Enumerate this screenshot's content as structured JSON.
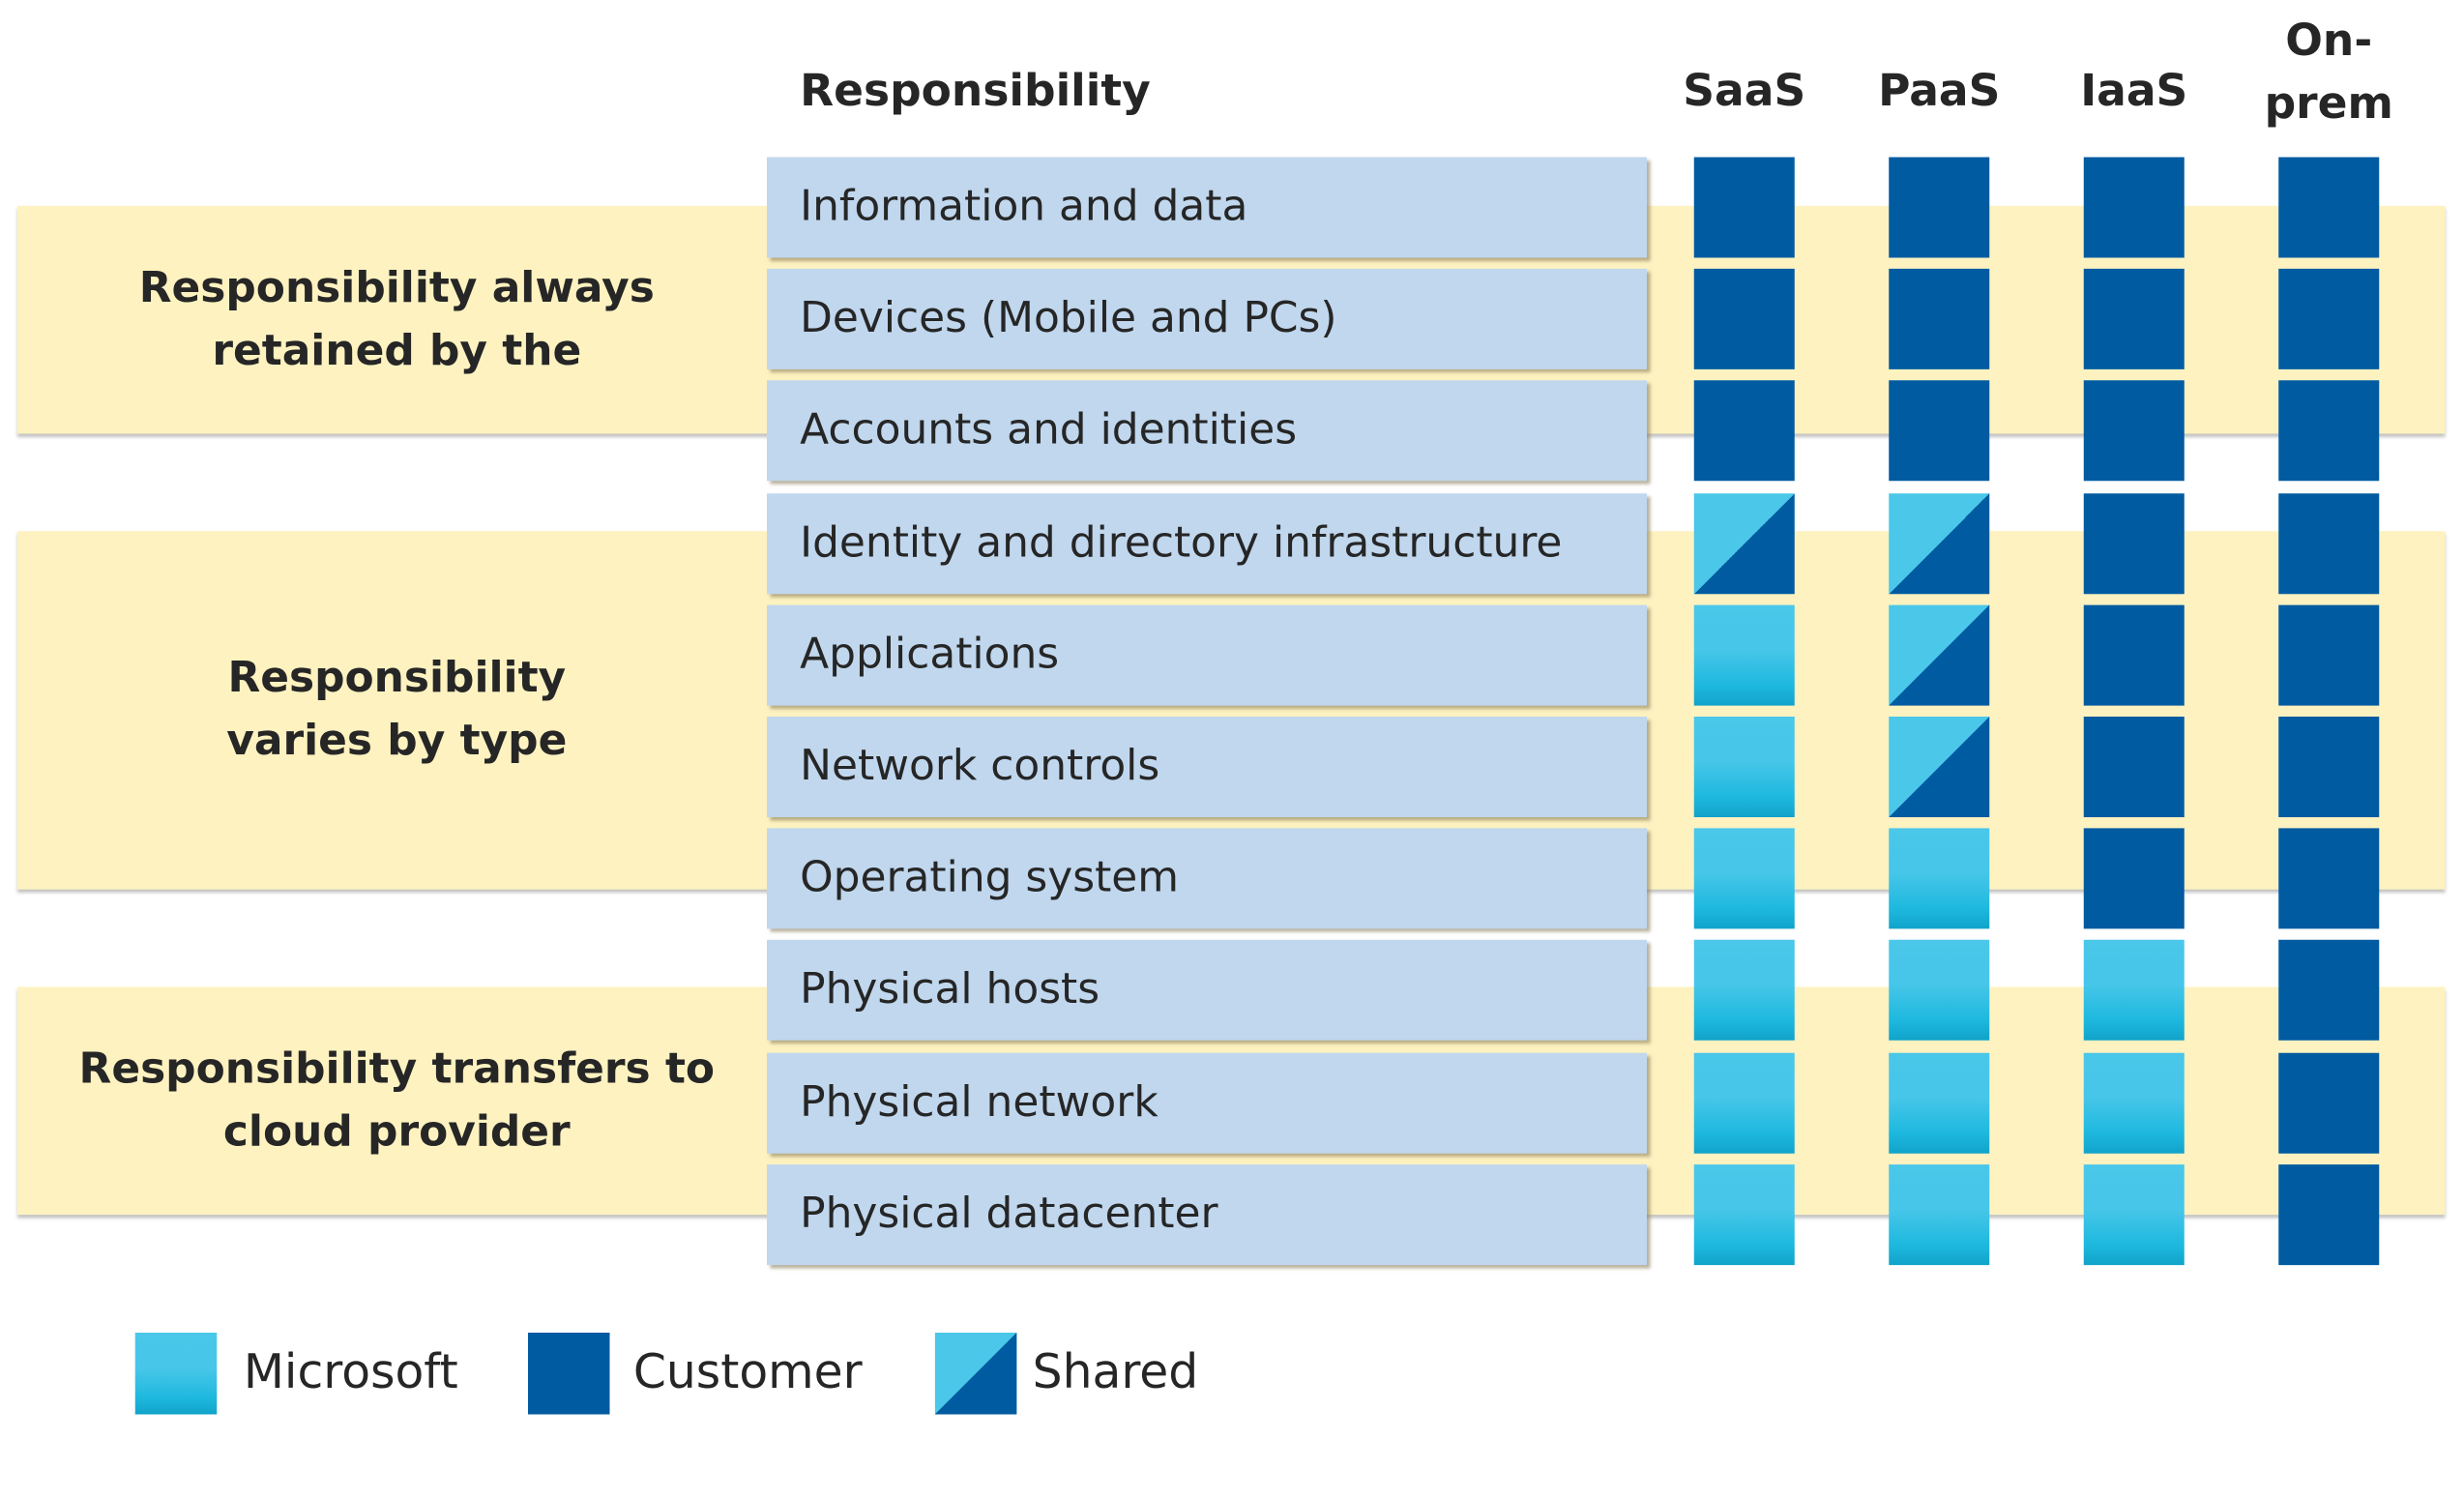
{
  "header": {
    "responsibility": "Responsibility"
  },
  "columns": [
    "SaaS",
    "PaaS",
    "IaaS",
    "On-prem"
  ],
  "column_lines": {
    "onprem_1": "On-",
    "onprem_2": "prem"
  },
  "bands": [
    {
      "label": "Responsibility always retained by the"
    },
    {
      "label": "Responsibility varies by type"
    },
    {
      "label": "Responsibility transfers to cloud provider"
    }
  ],
  "rows": [
    {
      "label": "Information and data",
      "cells": [
        "customer",
        "customer",
        "customer",
        "customer"
      ]
    },
    {
      "label": "Devices (Mobile and PCs)",
      "cells": [
        "customer",
        "customer",
        "customer",
        "customer"
      ]
    },
    {
      "label": "Accounts and identities",
      "cells": [
        "customer",
        "customer",
        "customer",
        "customer"
      ]
    },
    {
      "label": "Identity and directory infrastructure",
      "cells": [
        "shared",
        "shared",
        "customer",
        "customer"
      ]
    },
    {
      "label": "Applications",
      "cells": [
        "microsoft",
        "shared",
        "customer",
        "customer"
      ]
    },
    {
      "label": "Network controls",
      "cells": [
        "microsoft",
        "shared",
        "customer",
        "customer"
      ]
    },
    {
      "label": "Operating system",
      "cells": [
        "microsoft",
        "microsoft",
        "customer",
        "customer"
      ]
    },
    {
      "label": "Physical hosts",
      "cells": [
        "microsoft",
        "microsoft",
        "microsoft",
        "customer"
      ]
    },
    {
      "label": "Physical network",
      "cells": [
        "microsoft",
        "microsoft",
        "microsoft",
        "customer"
      ]
    },
    {
      "label": "Physical datacenter",
      "cells": [
        "microsoft",
        "microsoft",
        "microsoft",
        "customer"
      ]
    }
  ],
  "legend": [
    {
      "key": "microsoft",
      "label": "Microsoft"
    },
    {
      "key": "customer",
      "label": "Customer"
    },
    {
      "key": "shared",
      "label": "Shared"
    }
  ],
  "colors": {
    "customer": "#005BA1",
    "microsoft": "#4AC7E9",
    "band": "#FDF2C0",
    "row": "#C0D7EE"
  }
}
